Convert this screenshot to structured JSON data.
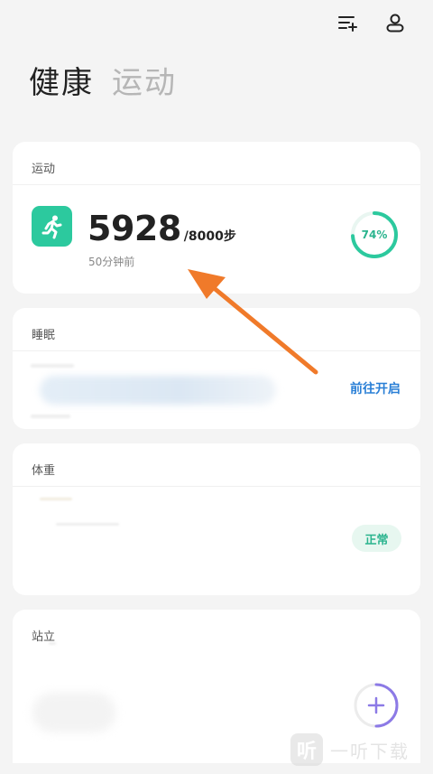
{
  "header": {
    "tabs": [
      {
        "label": "健康",
        "active": true
      },
      {
        "label": "运动",
        "active": false
      }
    ],
    "icons": [
      "add-list-icon",
      "user-icon"
    ]
  },
  "exercise": {
    "title": "运动",
    "steps": "5928",
    "goal": "/8000步",
    "updated": "50分钟前",
    "progress_label": "74%",
    "progress": 0.74,
    "accent": "#2cc99e"
  },
  "sleep": {
    "title": "睡眠",
    "action_label": "前往开启",
    "action_color": "#2a7fd6"
  },
  "weight": {
    "title": "体重",
    "status": "正常"
  },
  "standing": {
    "title": "站立",
    "add_icon": "plus-icon",
    "ring_color": "#8c7ae6"
  },
  "watermark": {
    "logo_char": "听",
    "text": "一听下载"
  },
  "annotation": {
    "arrow_color": "#f07a2a"
  }
}
